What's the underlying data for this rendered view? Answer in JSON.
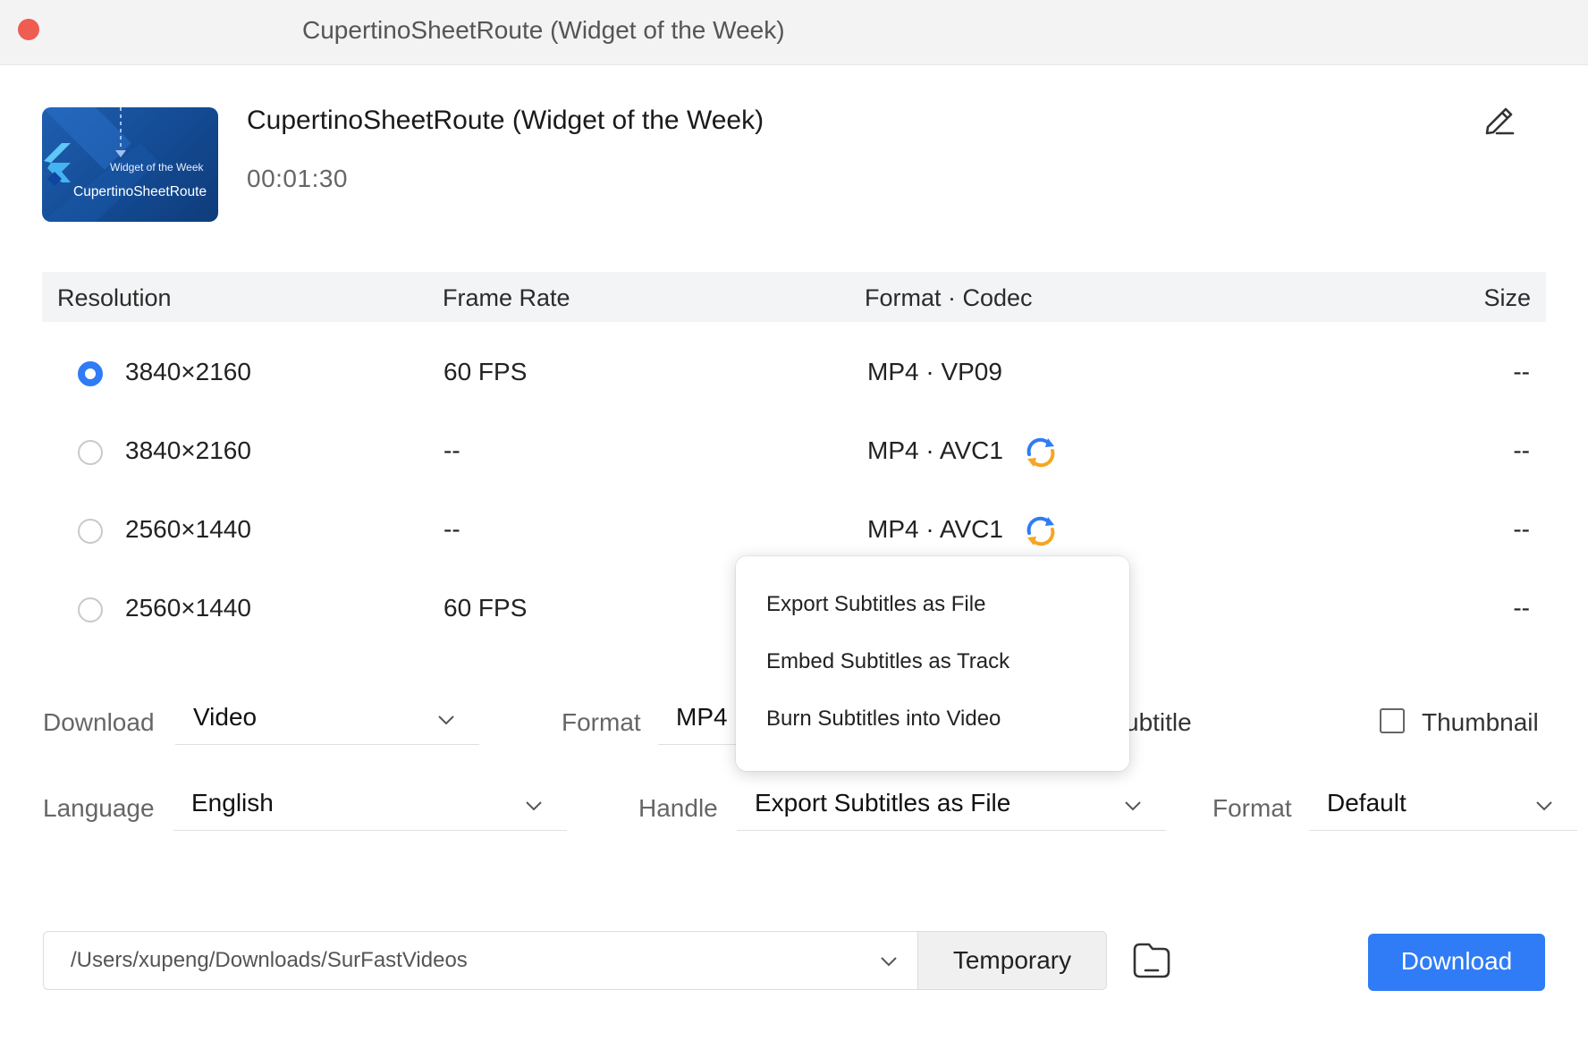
{
  "window": {
    "title": "CupertinoSheetRoute (Widget of the Week)"
  },
  "video": {
    "thumbnail_small_text": "Widget of the Week",
    "thumbnail_big_text": "CupertinoSheetRoute",
    "title": "CupertinoSheetRoute (Widget of the Week)",
    "duration": "00:01:30"
  },
  "table": {
    "headers": {
      "resolution": "Resolution",
      "frame_rate": "Frame Rate",
      "format_codec": "Format · Codec",
      "size": "Size"
    },
    "rows": [
      {
        "resolution": "3840×2160",
        "frame_rate": "60 FPS",
        "format_codec": "MP4 · VP09",
        "size": "--",
        "selected": true,
        "convert_icon": false
      },
      {
        "resolution": "3840×2160",
        "frame_rate": "--",
        "format_codec": "MP4 · AVC1",
        "size": "--",
        "selected": false,
        "convert_icon": true
      },
      {
        "resolution": "2560×1440",
        "frame_rate": "--",
        "format_codec": "MP4 · AVC1",
        "size": "--",
        "selected": false,
        "convert_icon": true
      },
      {
        "resolution": "2560×1440",
        "frame_rate": "60 FPS",
        "format_codec": "",
        "size": "--",
        "selected": false,
        "convert_icon": false
      }
    ]
  },
  "options": {
    "download_label": "Download",
    "download_value": "Video",
    "format_label": "Format",
    "format_value": "MP4",
    "subtitle_label_partial": "ubtitle",
    "thumbnail_label": "Thumbnail",
    "thumbnail_checked": false,
    "language_label": "Language",
    "language_value": "English",
    "handle_label": "Handle",
    "handle_value": "Export Subtitles as File",
    "subtitle_format_label": "Format",
    "subtitle_format_value": "Default"
  },
  "handle_menu": {
    "items": [
      "Export Subtitles as File",
      "Embed Subtitles as Track",
      "Burn Subtitles into Video"
    ]
  },
  "footer": {
    "path": "/Users/xupeng/Downloads/SurFastVideos",
    "temporary_label": "Temporary",
    "download_button": "Download"
  },
  "colors": {
    "accent": "#2f7cf6",
    "close": "#ee5c52",
    "sync_blue": "#2f7cf6",
    "sync_orange": "#f5a623"
  },
  "icons": [
    "close-icon",
    "flutter-logo-icon",
    "edit-icon",
    "sync-icon",
    "chevron-down-icon",
    "folder-icon"
  ]
}
